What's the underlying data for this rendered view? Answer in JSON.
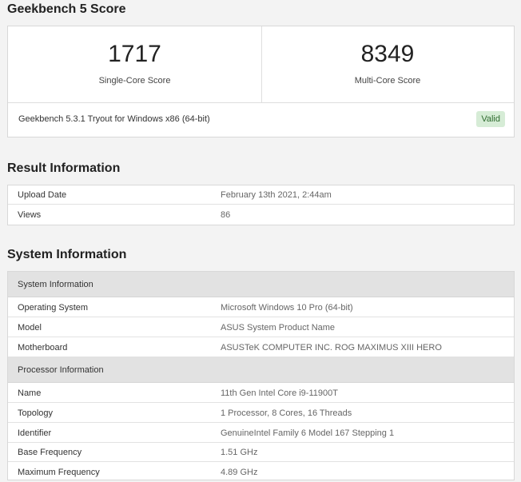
{
  "score": {
    "heading": "Geekbench 5 Score",
    "single": {
      "value": "1717",
      "label": "Single-Core Score"
    },
    "multi": {
      "value": "8349",
      "label": "Multi-Core Score"
    },
    "version": "Geekbench 5.3.1 Tryout for Windows x86 (64-bit)",
    "badge": "Valid"
  },
  "result": {
    "heading": "Result Information",
    "rows": [
      {
        "key": "Upload Date",
        "value": "February 13th 2021, 2:44am"
      },
      {
        "key": "Views",
        "value": "86"
      }
    ]
  },
  "system": {
    "heading": "System Information",
    "sections": [
      {
        "title": "System Information",
        "rows": [
          {
            "key": "Operating System",
            "value": "Microsoft Windows 10 Pro (64-bit)"
          },
          {
            "key": "Model",
            "value": "ASUS System Product Name"
          },
          {
            "key": "Motherboard",
            "value": "ASUSTeK COMPUTER INC. ROG MAXIMUS XIII HERO"
          }
        ]
      },
      {
        "title": "Processor Information",
        "rows": [
          {
            "key": "Name",
            "value": "11th Gen Intel Core i9-11900T"
          },
          {
            "key": "Topology",
            "value": "1 Processor, 8 Cores, 16 Threads"
          },
          {
            "key": "Identifier",
            "value": "GenuineIntel Family 6 Model 167 Stepping 1"
          },
          {
            "key": "Base Frequency",
            "value": "1.51 GHz"
          },
          {
            "key": "Maximum Frequency",
            "value": "4.89 GHz"
          }
        ]
      }
    ]
  }
}
